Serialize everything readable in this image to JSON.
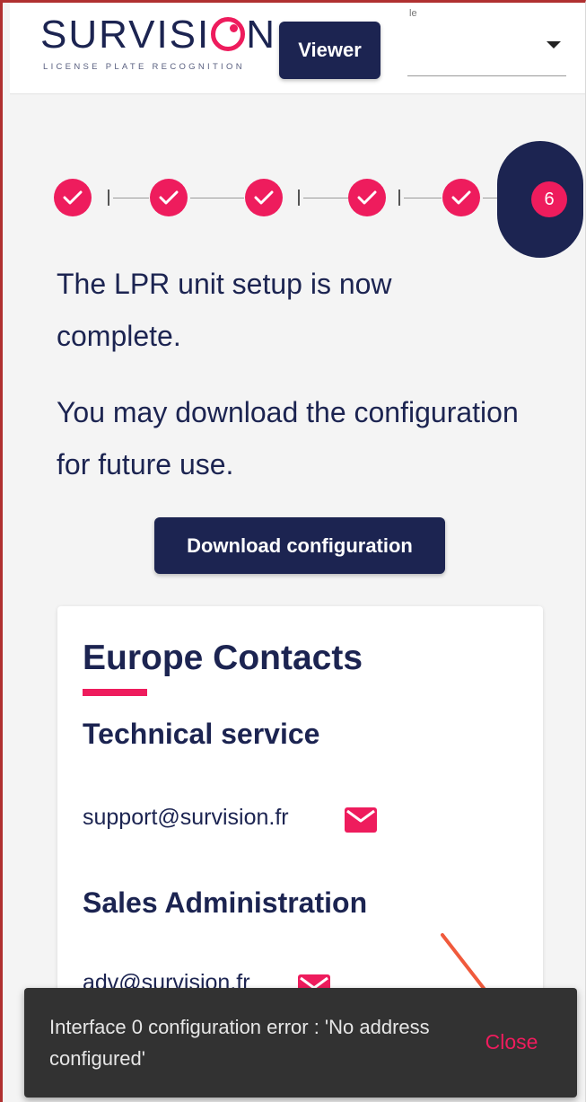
{
  "header": {
    "logo_word_start": "SURVISI",
    "logo_word_end": "N",
    "logo_tagline": "LICENSE PLATE RECOGNITION",
    "viewer_label": "Viewer",
    "select_label": "le",
    "select_value": ""
  },
  "stepper": {
    "current_step": "6",
    "completed_steps": 5
  },
  "main": {
    "message_complete": "The LPR unit setup is now complete.",
    "message_download": "You may download the configuration for future use.",
    "download_button": "Download configuration"
  },
  "contacts": {
    "title": "Europe Contacts",
    "sections": [
      {
        "title": "Technical service",
        "email": "support@survision.fr"
      },
      {
        "title": "Sales Administration",
        "email": "adv@survision.fr"
      }
    ]
  },
  "snackbar": {
    "message": "Interface 0 configuration error : 'No address configured'",
    "close_label": "Close"
  },
  "colors": {
    "navy": "#1c2451",
    "accent": "#ee1c5d",
    "snackbar_bg": "#323232"
  }
}
